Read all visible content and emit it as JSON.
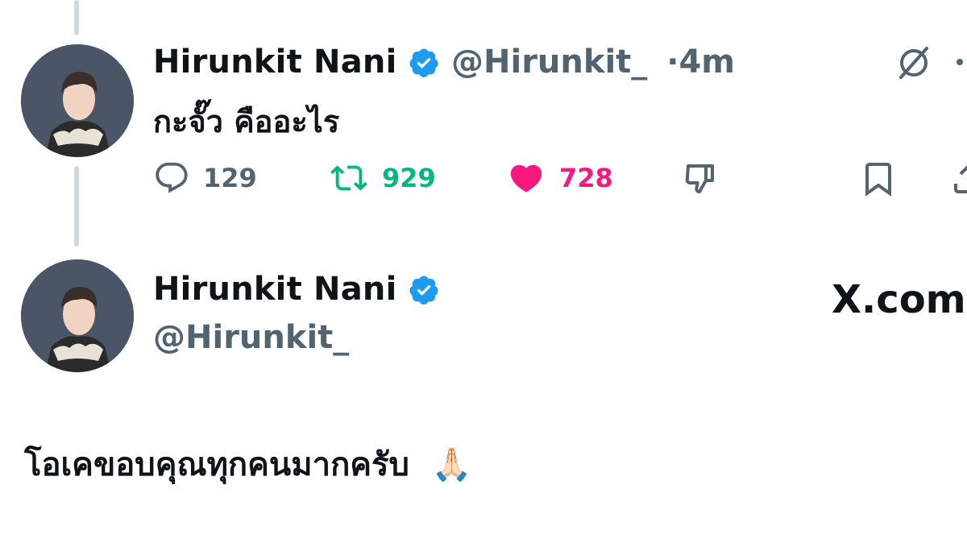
{
  "tweet1": {
    "name": "Hirunkit Nani",
    "handle": "@Hirunkit_",
    "separator": "·",
    "time": "4m",
    "text": "กะจั๊ว คืออะไร",
    "actions": {
      "reply_count": "129",
      "retweet_count": "929",
      "like_count": "728"
    },
    "colors": {
      "retweet": "#00ba7c",
      "like": "#f91880",
      "verified": "#1d9bf0"
    }
  },
  "tweet2": {
    "name": "Hirunkit Nani",
    "handle": "@Hirunkit_",
    "brand": "X.com",
    "text": "โอเคขอบคุณทุกคนมากครับ",
    "emoji": "🙏🏻"
  },
  "icons": [
    "slash-circle-icon",
    "more-dots-icon",
    "reply-icon",
    "retweet-icon",
    "like-icon",
    "dislike-icon",
    "bookmark-icon",
    "share-icon",
    "verified-badge-icon",
    "x-logo-icon"
  ]
}
